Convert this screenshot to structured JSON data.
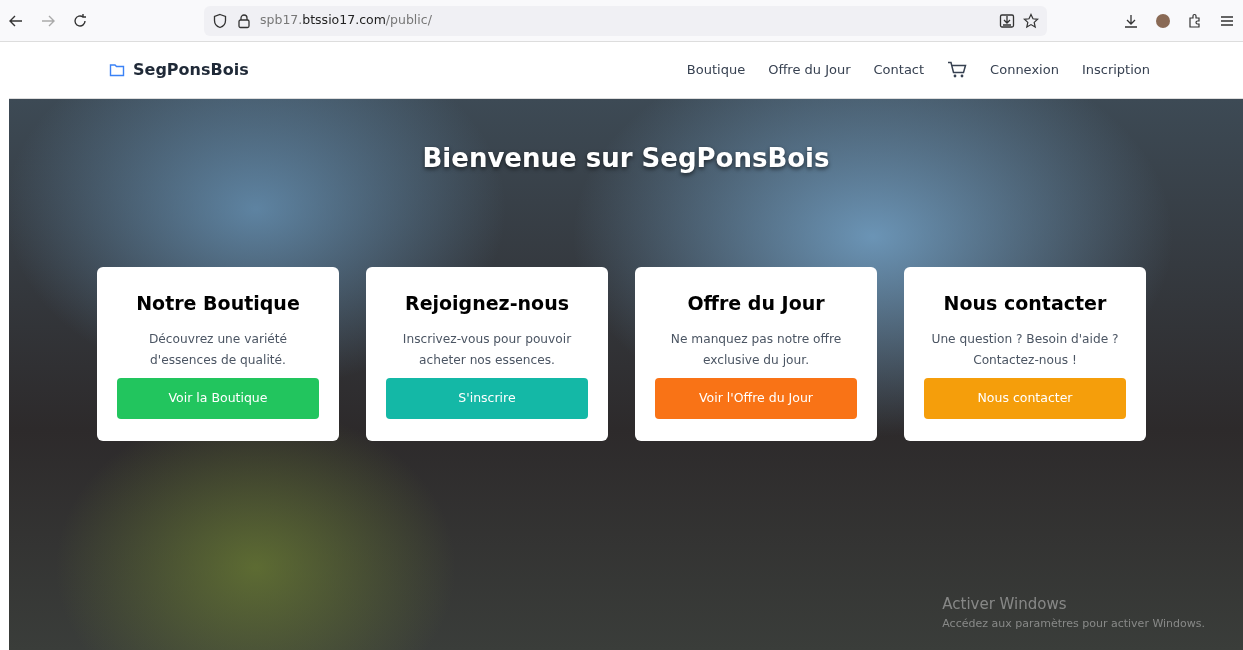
{
  "browser": {
    "url": {
      "subdomain": "spb17.",
      "domain": "btssio17.com",
      "path": "/public/"
    }
  },
  "navbar": {
    "brand": "SegPonsBois",
    "links": [
      {
        "kind": "text",
        "label": "Boutique"
      },
      {
        "kind": "text",
        "label": "Offre du Jour"
      },
      {
        "kind": "text",
        "label": "Contact"
      },
      {
        "kind": "cart"
      },
      {
        "kind": "text",
        "label": "Connexion"
      },
      {
        "kind": "text",
        "label": "Inscription"
      }
    ]
  },
  "hero": {
    "title": "Bienvenue sur SegPonsBois",
    "cards": [
      {
        "title": "Notre Boutique",
        "text": "Découvrez une variété d'essences de qualité.",
        "button": "Voir la Boutique",
        "color": "#22c55e"
      },
      {
        "title": "Rejoignez-nous",
        "text": "Inscrivez-vous pour pouvoir acheter nos essences.",
        "button": "S'inscrire",
        "color": "#14b8a6"
      },
      {
        "title": "Offre du Jour",
        "text": "Ne manquez pas notre offre exclusive du jour.",
        "button": "Voir l'Offre du Jour",
        "color": "#f97316"
      },
      {
        "title": "Nous contacter",
        "text": "Une question ? Besoin d'aide ? Contactez-nous !",
        "button": "Nous contacter",
        "color": "#f59e0b"
      }
    ]
  },
  "os_notice": {
    "title": "Activer Windows",
    "text": "Accédez aux paramètres pour activer Windows."
  }
}
